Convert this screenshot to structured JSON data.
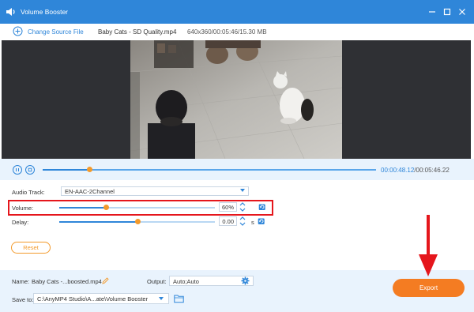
{
  "window": {
    "title": "Volume Booster",
    "minimize_icon": "minimize-icon",
    "maximize_icon": "maximize-icon",
    "close_icon": "close-icon"
  },
  "toolbar": {
    "change_source_label": "Change Source File",
    "file_name": "Baby Cats - SD Quality.mp4",
    "file_info": "640x360/00:05:46/15.30 MB"
  },
  "player": {
    "current_time": "00:00:48.12",
    "separator": "/",
    "total_time": "00:05:46.22",
    "progress_fraction": 0.14
  },
  "settings": {
    "audio_track_label": "Audio Track:",
    "audio_track_value": "EN-AAC-2Channel",
    "volume_label": "Volume:",
    "volume_value": "60%",
    "volume_fraction": 0.3,
    "delay_label": "Delay:",
    "delay_value": "0.00",
    "delay_fraction": 0.5,
    "delay_unit": "s",
    "reset_label": "Reset"
  },
  "bottom": {
    "name_label": "Name:",
    "name_value": "Baby Cats -...boosted.mp4",
    "output_label": "Output:",
    "output_value": "Auto;Auto",
    "save_to_label": "Save to:",
    "save_to_value": "C:\\AnyMP4 Studio\\A...ate\\Volume Booster",
    "export_label": "Export"
  },
  "colors": {
    "accent": "#2f86d9",
    "orange": "#f39a2b",
    "export": "#f47c22",
    "highlight": "#e5161c"
  }
}
